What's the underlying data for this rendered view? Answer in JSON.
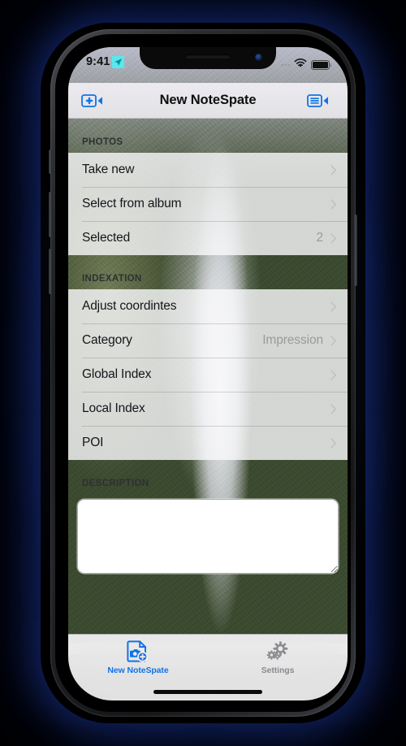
{
  "status_bar": {
    "time": "9:41",
    "location_icon": "location-arrow-icon",
    "signal_icon": "signal-dots-icon",
    "wifi_icon": "wifi-icon",
    "battery_icon": "battery-full-icon"
  },
  "nav_bar": {
    "title": "New NoteSpate",
    "left_button_icon": "video-camera-plus-icon",
    "right_button_icon": "video-camera-list-icon"
  },
  "sections": [
    {
      "header": "PHOTOS",
      "rows": [
        {
          "label": "Take new",
          "value": "",
          "accessory": "chevron-right-icon"
        },
        {
          "label": "Select from album",
          "value": "",
          "accessory": "chevron-right-icon"
        },
        {
          "label": "Selected",
          "value": "2",
          "accessory": "chevron-right-icon"
        }
      ]
    },
    {
      "header": "INDEXATION",
      "rows": [
        {
          "label": "Adjust coordintes",
          "value": "",
          "accessory": "chevron-right-icon"
        },
        {
          "label": "Category",
          "value": "Impression",
          "accessory": "chevron-right-icon"
        },
        {
          "label": "Global Index",
          "value": "",
          "accessory": "chevron-right-icon"
        },
        {
          "label": "Local Index",
          "value": "",
          "accessory": "chevron-right-icon"
        },
        {
          "label": "POI",
          "value": "",
          "accessory": "chevron-right-icon"
        }
      ]
    }
  ],
  "description": {
    "header": "DESCRIPTION",
    "value": "",
    "placeholder": ""
  },
  "tab_bar": {
    "tabs": [
      {
        "label": "New NoteSpate",
        "icon": "document-camera-plus-icon",
        "active": true
      },
      {
        "label": "Settings",
        "icon": "gears-icon",
        "active": false
      }
    ]
  },
  "colors": {
    "accent": "#1273e6",
    "inactive": "#8b8b90",
    "value_text": "#9a9aa0",
    "location_highlight": "#57e8ee"
  }
}
